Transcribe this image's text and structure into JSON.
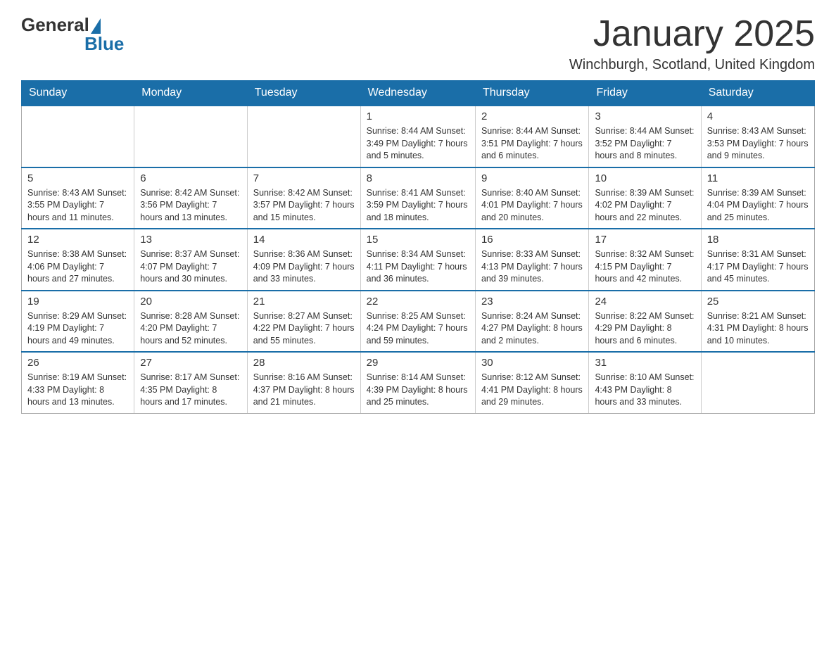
{
  "header": {
    "logo": {
      "general": "General",
      "blue": "Blue"
    },
    "title": "January 2025",
    "location": "Winchburgh, Scotland, United Kingdom"
  },
  "days_of_week": [
    "Sunday",
    "Monday",
    "Tuesday",
    "Wednesday",
    "Thursday",
    "Friday",
    "Saturday"
  ],
  "weeks": [
    [
      {
        "day": "",
        "info": ""
      },
      {
        "day": "",
        "info": ""
      },
      {
        "day": "",
        "info": ""
      },
      {
        "day": "1",
        "info": "Sunrise: 8:44 AM\nSunset: 3:49 PM\nDaylight: 7 hours and 5 minutes."
      },
      {
        "day": "2",
        "info": "Sunrise: 8:44 AM\nSunset: 3:51 PM\nDaylight: 7 hours and 6 minutes."
      },
      {
        "day": "3",
        "info": "Sunrise: 8:44 AM\nSunset: 3:52 PM\nDaylight: 7 hours and 8 minutes."
      },
      {
        "day": "4",
        "info": "Sunrise: 8:43 AM\nSunset: 3:53 PM\nDaylight: 7 hours and 9 minutes."
      }
    ],
    [
      {
        "day": "5",
        "info": "Sunrise: 8:43 AM\nSunset: 3:55 PM\nDaylight: 7 hours and 11 minutes."
      },
      {
        "day": "6",
        "info": "Sunrise: 8:42 AM\nSunset: 3:56 PM\nDaylight: 7 hours and 13 minutes."
      },
      {
        "day": "7",
        "info": "Sunrise: 8:42 AM\nSunset: 3:57 PM\nDaylight: 7 hours and 15 minutes."
      },
      {
        "day": "8",
        "info": "Sunrise: 8:41 AM\nSunset: 3:59 PM\nDaylight: 7 hours and 18 minutes."
      },
      {
        "day": "9",
        "info": "Sunrise: 8:40 AM\nSunset: 4:01 PM\nDaylight: 7 hours and 20 minutes."
      },
      {
        "day": "10",
        "info": "Sunrise: 8:39 AM\nSunset: 4:02 PM\nDaylight: 7 hours and 22 minutes."
      },
      {
        "day": "11",
        "info": "Sunrise: 8:39 AM\nSunset: 4:04 PM\nDaylight: 7 hours and 25 minutes."
      }
    ],
    [
      {
        "day": "12",
        "info": "Sunrise: 8:38 AM\nSunset: 4:06 PM\nDaylight: 7 hours and 27 minutes."
      },
      {
        "day": "13",
        "info": "Sunrise: 8:37 AM\nSunset: 4:07 PM\nDaylight: 7 hours and 30 minutes."
      },
      {
        "day": "14",
        "info": "Sunrise: 8:36 AM\nSunset: 4:09 PM\nDaylight: 7 hours and 33 minutes."
      },
      {
        "day": "15",
        "info": "Sunrise: 8:34 AM\nSunset: 4:11 PM\nDaylight: 7 hours and 36 minutes."
      },
      {
        "day": "16",
        "info": "Sunrise: 8:33 AM\nSunset: 4:13 PM\nDaylight: 7 hours and 39 minutes."
      },
      {
        "day": "17",
        "info": "Sunrise: 8:32 AM\nSunset: 4:15 PM\nDaylight: 7 hours and 42 minutes."
      },
      {
        "day": "18",
        "info": "Sunrise: 8:31 AM\nSunset: 4:17 PM\nDaylight: 7 hours and 45 minutes."
      }
    ],
    [
      {
        "day": "19",
        "info": "Sunrise: 8:29 AM\nSunset: 4:19 PM\nDaylight: 7 hours and 49 minutes."
      },
      {
        "day": "20",
        "info": "Sunrise: 8:28 AM\nSunset: 4:20 PM\nDaylight: 7 hours and 52 minutes."
      },
      {
        "day": "21",
        "info": "Sunrise: 8:27 AM\nSunset: 4:22 PM\nDaylight: 7 hours and 55 minutes."
      },
      {
        "day": "22",
        "info": "Sunrise: 8:25 AM\nSunset: 4:24 PM\nDaylight: 7 hours and 59 minutes."
      },
      {
        "day": "23",
        "info": "Sunrise: 8:24 AM\nSunset: 4:27 PM\nDaylight: 8 hours and 2 minutes."
      },
      {
        "day": "24",
        "info": "Sunrise: 8:22 AM\nSunset: 4:29 PM\nDaylight: 8 hours and 6 minutes."
      },
      {
        "day": "25",
        "info": "Sunrise: 8:21 AM\nSunset: 4:31 PM\nDaylight: 8 hours and 10 minutes."
      }
    ],
    [
      {
        "day": "26",
        "info": "Sunrise: 8:19 AM\nSunset: 4:33 PM\nDaylight: 8 hours and 13 minutes."
      },
      {
        "day": "27",
        "info": "Sunrise: 8:17 AM\nSunset: 4:35 PM\nDaylight: 8 hours and 17 minutes."
      },
      {
        "day": "28",
        "info": "Sunrise: 8:16 AM\nSunset: 4:37 PM\nDaylight: 8 hours and 21 minutes."
      },
      {
        "day": "29",
        "info": "Sunrise: 8:14 AM\nSunset: 4:39 PM\nDaylight: 8 hours and 25 minutes."
      },
      {
        "day": "30",
        "info": "Sunrise: 8:12 AM\nSunset: 4:41 PM\nDaylight: 8 hours and 29 minutes."
      },
      {
        "day": "31",
        "info": "Sunrise: 8:10 AM\nSunset: 4:43 PM\nDaylight: 8 hours and 33 minutes."
      },
      {
        "day": "",
        "info": ""
      }
    ]
  ]
}
